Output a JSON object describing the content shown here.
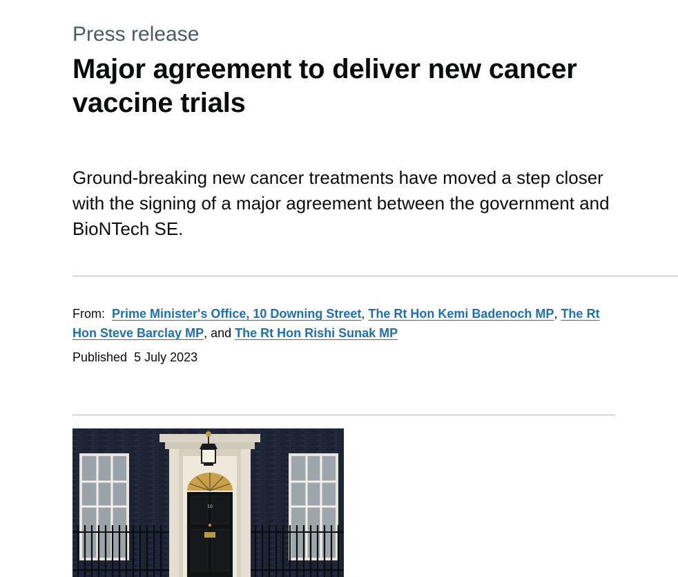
{
  "header": {
    "caption": "Press release",
    "title": "Major agreement to deliver new cancer vaccine trials"
  },
  "lede": "Ground-breaking new cancer treatments have moved a step closer with the signing of a major agreement between the government and BioNTech SE.",
  "metadata": {
    "from_label": "From:",
    "organisations": [
      "Prime Minister's Office, 10 Downing Street",
      "The Rt Hon Kemi Badenoch MP",
      "The Rt Hon Steve Barclay MP",
      "The Rt Hon Rishi Sunak MP"
    ],
    "separator": ", ",
    "and_text": ", and ",
    "published_label": "Published",
    "published_date": "5 July 2023"
  },
  "image": {
    "door_number": "10",
    "icon": "downing-street-photo"
  },
  "colors": {
    "link": "#1d70b8",
    "text": "#0b0c0c",
    "secondary_text": "#505a5f",
    "border": "#b1b4b6"
  }
}
